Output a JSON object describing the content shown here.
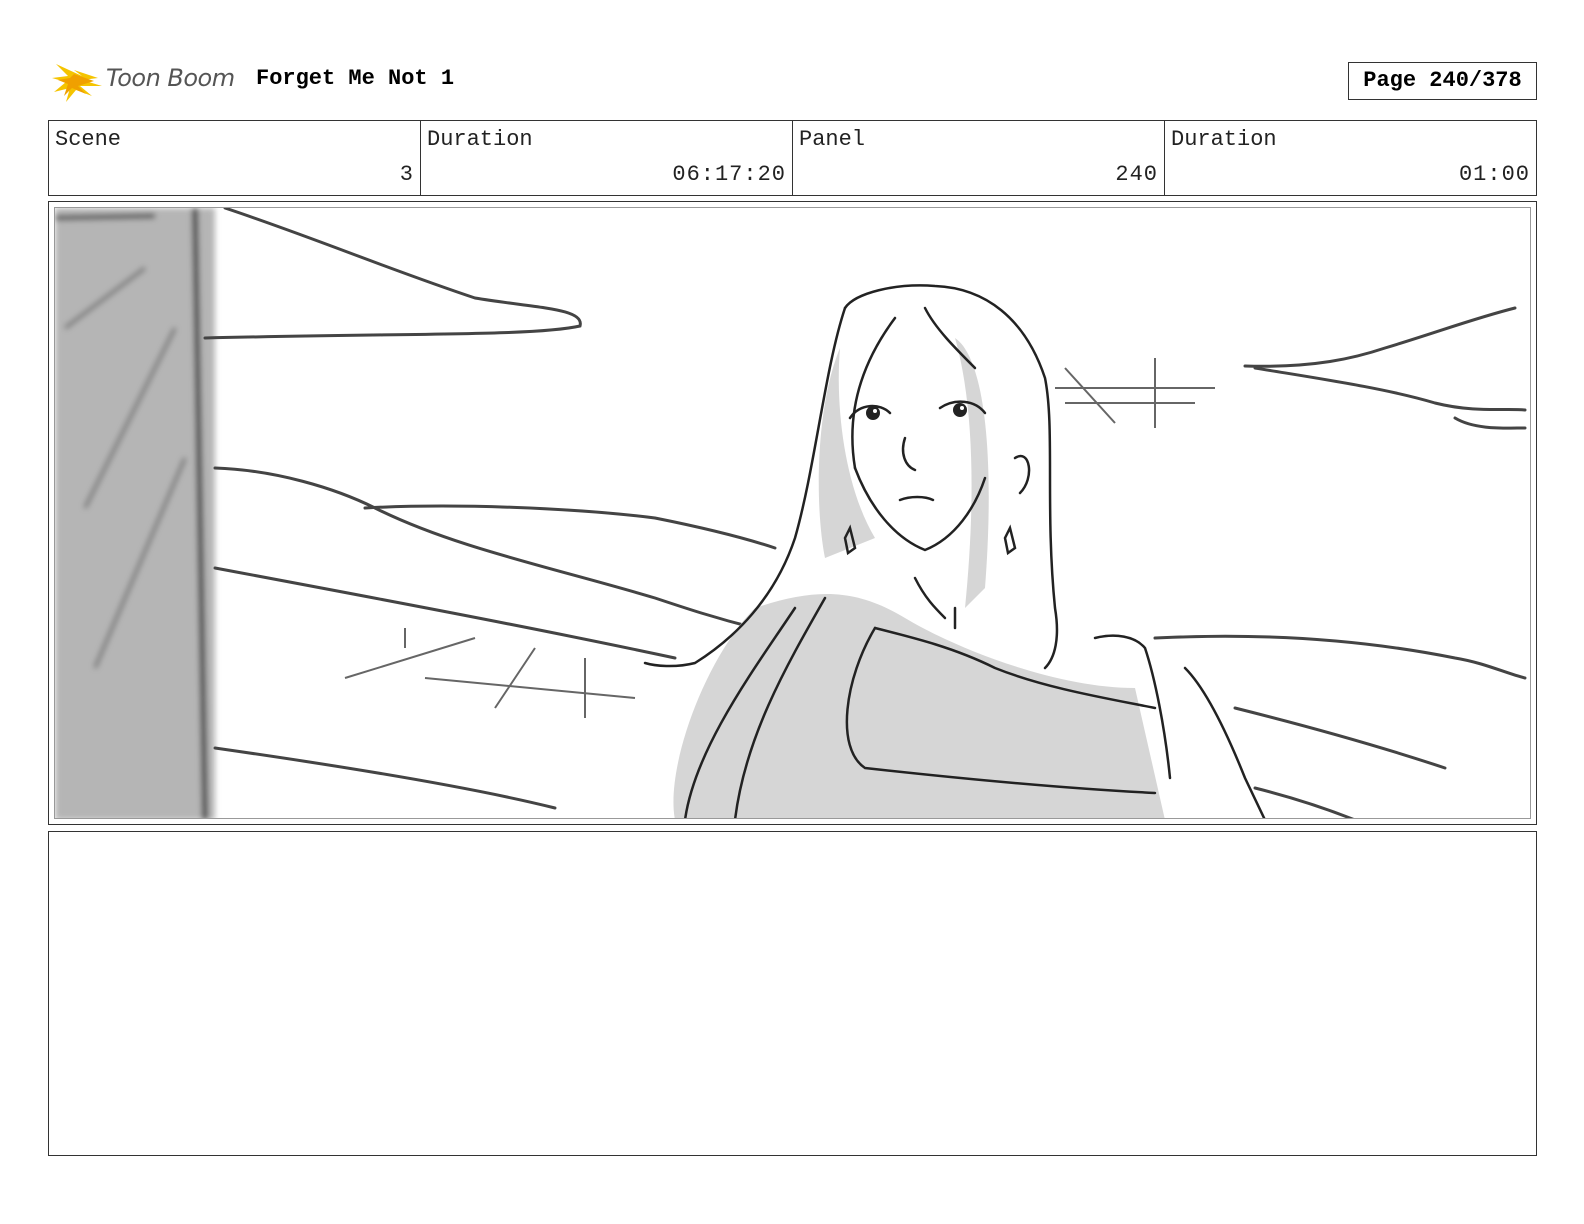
{
  "header": {
    "logo_text": "Toon Boom",
    "logo_icon": "starburst-logo-icon",
    "title": "Forget Me Not 1",
    "page": "Page 240/378"
  },
  "info": {
    "scene_label": "Scene",
    "scene_value": "3",
    "scene_duration_label": "Duration",
    "scene_duration_value": "06:17:20",
    "panel_label": "Panel",
    "panel_value": "240",
    "panel_duration_label": "Duration",
    "panel_duration_value": "01:00"
  },
  "panel": {
    "description": ""
  },
  "colors": {
    "logo_yellow": "#f5c400",
    "logo_orange": "#f0a000",
    "sketch_line": "#333333",
    "sketch_shade": "#d4d4d4"
  }
}
